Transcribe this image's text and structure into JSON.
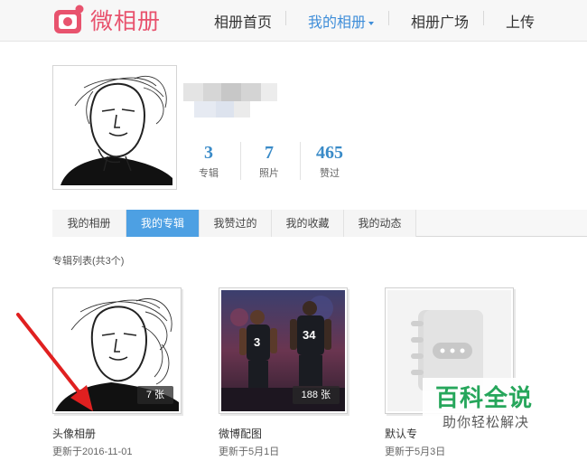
{
  "header": {
    "logo_text": "微相册",
    "nav": [
      {
        "label": "相册首页"
      },
      {
        "label": "我的相册"
      },
      {
        "label": "相册广场"
      },
      {
        "label": "上传"
      }
    ]
  },
  "profile": {
    "stats": [
      {
        "value": "3",
        "label": "专辑"
      },
      {
        "value": "7",
        "label": "照片"
      },
      {
        "value": "465",
        "label": "赞过"
      }
    ]
  },
  "tabs": [
    {
      "label": "我的相册"
    },
    {
      "label": "我的专辑"
    },
    {
      "label": "我赞过的"
    },
    {
      "label": "我的收藏"
    },
    {
      "label": "我的动态"
    }
  ],
  "album_list": {
    "title": "专辑列表(共3个)",
    "albums": [
      {
        "name": "头像相册",
        "count": "7 张",
        "updated": "更新于2016-11-01"
      },
      {
        "name": "微博配图",
        "count": "188 张",
        "updated": "更新于5月1日"
      },
      {
        "name": "默认专",
        "count": "",
        "updated": "更新于5月3日"
      }
    ]
  },
  "watermark": {
    "title": "百科全说",
    "subtitle": "助你轻松解决"
  },
  "colors": {
    "accent": "#4da0e3",
    "brand": "#e8536e",
    "stat_number": "#3a8bc8"
  }
}
